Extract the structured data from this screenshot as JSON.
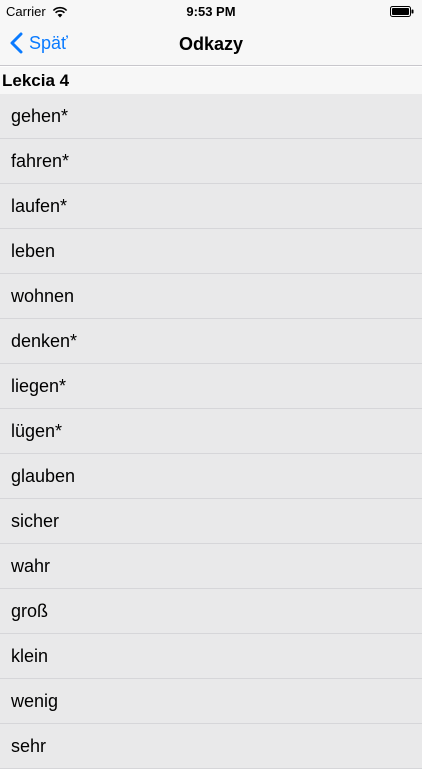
{
  "status_bar": {
    "carrier": "Carrier",
    "time": "9:53 PM"
  },
  "nav": {
    "back_label": "Späť",
    "title": "Odkazy"
  },
  "section": {
    "title": "Lekcia 4"
  },
  "items": [
    {
      "label": "gehen*"
    },
    {
      "label": "fahren*"
    },
    {
      "label": "laufen*"
    },
    {
      "label": "leben"
    },
    {
      "label": "wohnen"
    },
    {
      "label": "denken*"
    },
    {
      "label": "liegen*"
    },
    {
      "label": "lügen*"
    },
    {
      "label": "glauben"
    },
    {
      "label": "sicher"
    },
    {
      "label": "wahr"
    },
    {
      "label": "groß"
    },
    {
      "label": "klein"
    },
    {
      "label": "wenig"
    },
    {
      "label": "sehr"
    }
  ],
  "colors": {
    "accent": "#0a7bff",
    "row_background": "#e9e9ea",
    "bar_background": "#f7f7f7"
  }
}
